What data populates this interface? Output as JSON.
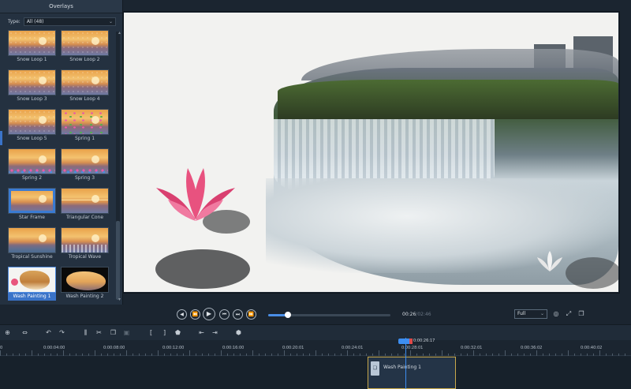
{
  "panel": {
    "title": "Overlays",
    "type_label": "Type:",
    "type_value": "All (48)",
    "items": [
      {
        "label": "Snow Loop 1",
        "style": "sunset snow"
      },
      {
        "label": "Snow Loop 2",
        "style": "sunset snow"
      },
      {
        "label": "Snow Loop 3",
        "style": "sunset snow"
      },
      {
        "label": "Snow Loop 4",
        "style": "sunset snow"
      },
      {
        "label": "Snow Loop 5",
        "style": "sunset snow"
      },
      {
        "label": "Spring 1",
        "style": "sunset spring"
      },
      {
        "label": "Spring 2",
        "style": "sunset spring2"
      },
      {
        "label": "Spring 3",
        "style": "sunset spring2"
      },
      {
        "label": "Star Frame",
        "style": "sunset frame"
      },
      {
        "label": "Triangular Cone",
        "style": "sunset cone"
      },
      {
        "label": "Tropical Sunshine",
        "style": "sunset sunshine"
      },
      {
        "label": "Tropical Wave",
        "style": "sunset wave"
      },
      {
        "label": "Wash Painting 1",
        "style": "wash1"
      },
      {
        "label": "Wash Painting 2",
        "style": "wash2"
      }
    ],
    "selected_index": 12
  },
  "player": {
    "current_time": "00:26",
    "duration": "/02:46",
    "progress": 0.16,
    "zoom": "Full",
    "icons": [
      "prev-clip-icon",
      "step-back-icon",
      "play-icon",
      "first-frame-icon",
      "last-frame-icon",
      "step-forward-icon"
    ]
  },
  "toolbar": {
    "buttons": [
      {
        "name": "zoom-icon",
        "glyph": "⊕"
      },
      {
        "name": "fit-icon",
        "glyph": "⇔"
      },
      {
        "name": "undo-icon",
        "glyph": "↶"
      },
      {
        "name": "redo-icon",
        "glyph": "↷"
      },
      {
        "name": "split-icon",
        "glyph": "⫼"
      },
      {
        "name": "cut-icon",
        "glyph": "✂"
      },
      {
        "name": "copy-icon",
        "glyph": "❐"
      },
      {
        "name": "paste-icon",
        "glyph": "▣"
      },
      {
        "name": "mark-in-icon",
        "glyph": "["
      },
      {
        "name": "mark-out-icon",
        "glyph": "]"
      },
      {
        "name": "marker-icon",
        "glyph": "⬟"
      },
      {
        "name": "go-start-icon",
        "glyph": "⇤"
      },
      {
        "name": "go-end-icon",
        "glyph": "⇥"
      },
      {
        "name": "add-marker-icon",
        "glyph": "⬢"
      }
    ]
  },
  "timeline": {
    "ticks": [
      "0",
      "0:00:04:00",
      "0:00:08:00",
      "0:00:12:00",
      "0:00:16:00",
      "0:00:20:01",
      "0:00:24:01",
      "0:00:28:01",
      "0:00:32:01",
      "0:00:36:02",
      "0:00:40:02"
    ],
    "playhead_time": "0:00:26:17",
    "clip_label": "Wash Painting 1"
  }
}
